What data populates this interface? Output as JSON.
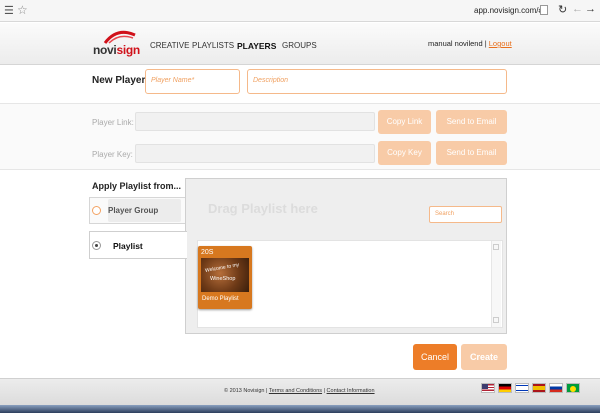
{
  "browser": {
    "url": "app.novisign.com/#"
  },
  "header": {
    "logo": {
      "prefix": "novi",
      "accent": "sign"
    },
    "nav": [
      "CREATIVE",
      "PLAYLISTS",
      "PLAYERS",
      "GROUPS"
    ],
    "active_nav": "PLAYERS",
    "user": "manual novilend",
    "separator": "|",
    "logout": "Logout"
  },
  "new_player": {
    "label": "New Player",
    "name_placeholder": "Player Name*",
    "description_placeholder": "Description"
  },
  "link_key": {
    "link_label": "Player Link:",
    "key_label": "Player Key:",
    "copy_link": "Copy Link",
    "copy_key": "Copy Key",
    "send_email": "Send to Email"
  },
  "apply": {
    "label": "Apply Playlist from...",
    "options": [
      "Player Group",
      "Playlist"
    ],
    "selected": "Playlist",
    "drag_text": "Drag Playlist here",
    "search_placeholder": "Search",
    "playlists": [
      {
        "duration": "20S",
        "thumb_line1": "Welcome to my",
        "thumb_line2": "WineShop",
        "name": "Demo Playlist"
      }
    ]
  },
  "actions": {
    "cancel": "Cancel",
    "create": "Create"
  },
  "footer": {
    "copyright": "© 2013 Novisign",
    "sep": "|",
    "terms": "Terms and Conditions",
    "contact": "Contact Information",
    "languages": [
      "English",
      "German",
      "Hebrew",
      "Spanish",
      "Russian",
      "Portuguese"
    ]
  },
  "colors": {
    "accent": "#ed7d28",
    "accent_light": "#f8cba7",
    "brand_red": "#d0111a"
  }
}
